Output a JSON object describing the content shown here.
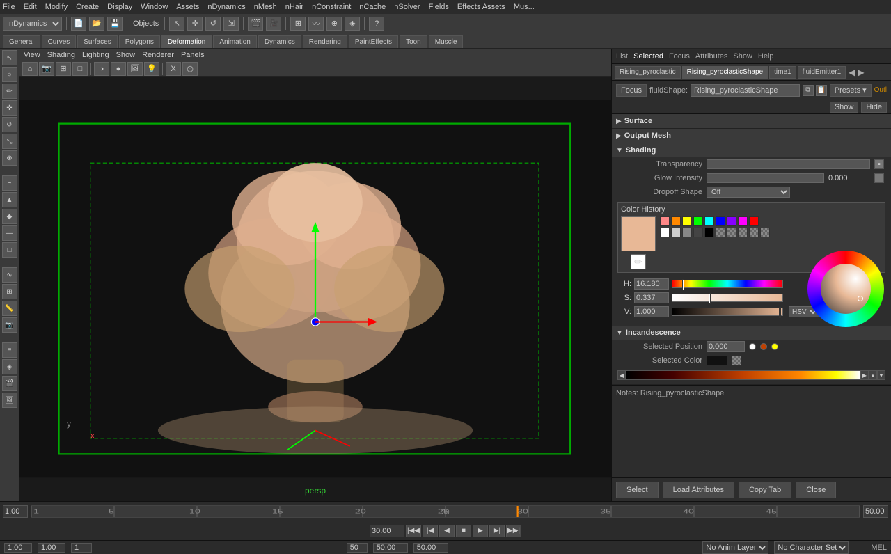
{
  "menu": {
    "items": [
      "File",
      "Edit",
      "Modify",
      "Create",
      "Display",
      "Window",
      "Assets",
      "nDynamics",
      "nMesh",
      "nHair",
      "nConstraint",
      "nCache",
      "nSolver",
      "Fields",
      "Effects Assets",
      "Mus..."
    ]
  },
  "toolbar": {
    "dropdown_label": "nDynamics",
    "objects_label": "Objects"
  },
  "viewport": {
    "tabs": [
      "General",
      "Curves",
      "Surfaces",
      "Polygons",
      "Deformation",
      "Animation",
      "Dynamics",
      "Rendering",
      "PaintEffects",
      "Toon",
      "Muscle"
    ],
    "menu_items": [
      "View",
      "Shading",
      "Lighting",
      "Show",
      "Renderer",
      "Panels"
    ],
    "label": "persp",
    "active_tab": "Deformation"
  },
  "right_panel": {
    "nav_items": [
      "List",
      "Selected",
      "Focus",
      "Attributes",
      "Show",
      "Help"
    ],
    "active_nav": "Selected",
    "node_tabs": [
      "Rising_pyroclastic",
      "Rising_pyroclasticShape",
      "time1",
      "fluidEmitter1"
    ],
    "attr_header_label": "fluidShape:",
    "attr_header_value": "Rising_pyroclasticShape",
    "focus_btn": "Focus",
    "presets_btn": "Presets ▾",
    "outl_btn": "Outl",
    "show_btn": "Show",
    "hide_btn": "Hide",
    "sections": [
      {
        "name": "Surface",
        "expanded": false
      },
      {
        "name": "Output Mesh",
        "expanded": false
      },
      {
        "name": "Shading",
        "expanded": true
      }
    ],
    "shading": {
      "transparency_label": "Transparency",
      "glow_label": "Glow Intensity",
      "glow_value": "0.000",
      "dropoff_label": "Dropoff Shape",
      "dropoff_value": "Off"
    },
    "incandescence": {
      "section_label": "Incandescence",
      "position_label": "Selected Position",
      "position_value": "0.000",
      "color_label": "Selected Color"
    },
    "notes_label": "Notes: Rising_pyroclasticShape",
    "buttons": {
      "select": "Select",
      "load_attributes": "Load Attributes",
      "copy_tab": "Copy Tab",
      "close": "Close"
    }
  },
  "color_history": {
    "title": "Color History",
    "preview_color": "#e8b896",
    "swatches_row1": [
      "#f88",
      "#f80",
      "#ff0",
      "#0f0",
      "#0ff",
      "#00f",
      "#80f",
      "#f0f",
      "#f00"
    ],
    "swatches_row2": [
      "#fff",
      "#ccc",
      "#888",
      "#444",
      "#000",
      "checker",
      "checker",
      "checker",
      "checker",
      "checker"
    ]
  },
  "color_picker": {
    "h_label": "H:",
    "h_value": "16.180",
    "s_label": "S:",
    "s_value": "0.337",
    "v_label": "V:",
    "v_value": "1.000",
    "mode_label": "HSV"
  },
  "timeline": {
    "current_frame": "30",
    "frame_display": "30.00",
    "start_frame": "1",
    "end_frame": "50",
    "range_start": "1.00",
    "range_end": "50.00"
  },
  "status_bar": {
    "value1": "1.00",
    "value2": "1.00",
    "frame": "1",
    "pos": "50",
    "time1": "50.00",
    "time2": "50.00",
    "anim_layer": "No Anim Layer",
    "char_set": "No Character Set",
    "mode": "MEL"
  }
}
